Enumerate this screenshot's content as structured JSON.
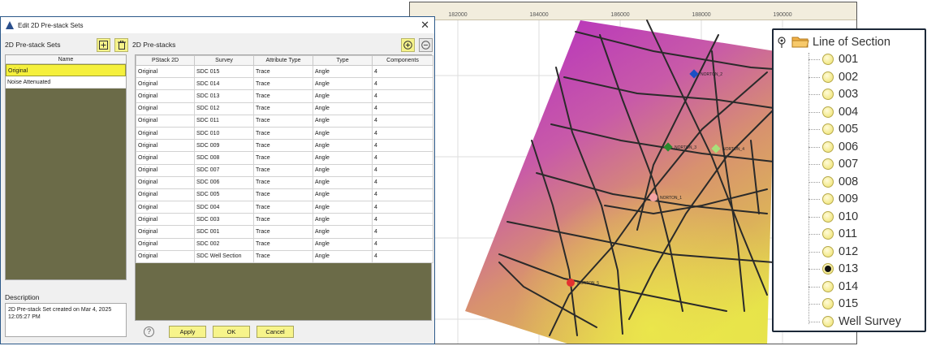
{
  "dialog": {
    "title": "Edit 2D Pre-stack Sets",
    "close_glyph": "✕",
    "sets_panel": {
      "title": "2D Pre-stack Sets",
      "column": "Name",
      "items": [
        "Original",
        "Noise Attenuated"
      ],
      "selected_index": 0,
      "add_icon": "add-box-icon",
      "delete_icon": "trash-icon"
    },
    "description": {
      "label": "Description",
      "text": "2D Pre-stack Set created on Mar 4, 2025 12:05:27 PM"
    },
    "prestacks_panel": {
      "title": "2D Pre-stacks",
      "columns": [
        "PStack 2D",
        "Survey",
        "Attribute Type",
        "Type",
        "Components"
      ],
      "rows": [
        [
          "Original",
          "SDC 015",
          "Trace",
          "Angle",
          "4"
        ],
        [
          "Original",
          "SDC 014",
          "Trace",
          "Angle",
          "4"
        ],
        [
          "Original",
          "SDC 013",
          "Trace",
          "Angle",
          "4"
        ],
        [
          "Original",
          "SDC 012",
          "Trace",
          "Angle",
          "4"
        ],
        [
          "Original",
          "SDC 011",
          "Trace",
          "Angle",
          "4"
        ],
        [
          "Original",
          "SDC 010",
          "Trace",
          "Angle",
          "4"
        ],
        [
          "Original",
          "SDC 009",
          "Trace",
          "Angle",
          "4"
        ],
        [
          "Original",
          "SDC 008",
          "Trace",
          "Angle",
          "4"
        ],
        [
          "Original",
          "SDC 007",
          "Trace",
          "Angle",
          "4"
        ],
        [
          "Original",
          "SDC 006",
          "Trace",
          "Angle",
          "4"
        ],
        [
          "Original",
          "SDC 005",
          "Trace",
          "Angle",
          "4"
        ],
        [
          "Original",
          "SDC 004",
          "Trace",
          "Angle",
          "4"
        ],
        [
          "Original",
          "SDC 003",
          "Trace",
          "Angle",
          "4"
        ],
        [
          "Original",
          "SDC 001",
          "Trace",
          "Angle",
          "4"
        ],
        [
          "Original",
          "SDC 002",
          "Trace",
          "Angle",
          "4"
        ],
        [
          "Original",
          "SDC Well Section",
          "Trace",
          "Angle",
          "4"
        ]
      ]
    },
    "buttons": {
      "help": "?",
      "apply": "Apply",
      "ok": "OK",
      "cancel": "Cancel"
    }
  },
  "map": {
    "x_ticks": [
      "182000",
      "184000",
      "186000",
      "188000",
      "190000"
    ],
    "wells": [
      "NORTON_1",
      "NORTON_2",
      "NORTON_3",
      "NORTON_4",
      "NORTON_5"
    ],
    "colors": {
      "magenta": "#c23fbe",
      "orange": "#d99a66",
      "yellow": "#e3e24e",
      "lines": "#2a2a2a"
    }
  },
  "tree": {
    "root_label": "Line of Section",
    "items": [
      "001",
      "002",
      "003",
      "004",
      "005",
      "006",
      "007",
      "008",
      "009",
      "010",
      "011",
      "012",
      "013",
      "014",
      "015",
      "Well Survey"
    ],
    "selected": "013"
  }
}
